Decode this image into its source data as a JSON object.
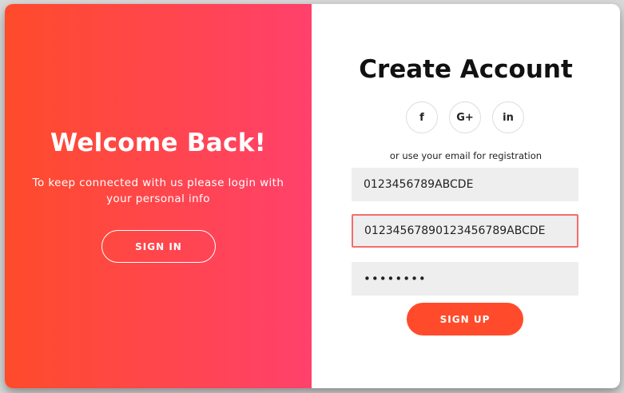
{
  "overlay": {
    "title": "Welcome Back!",
    "message": "To keep connected with us please login with your personal info",
    "signin_label": "SIGN IN"
  },
  "form": {
    "title": "Create Account",
    "social": [
      {
        "name": "facebook",
        "glyph": "f",
        "icon": "facebook-icon"
      },
      {
        "name": "google-plus",
        "glyph": "G+",
        "icon": "google-plus-icon"
      },
      {
        "name": "linkedin",
        "glyph": "in",
        "icon": "linkedin-icon"
      }
    ],
    "hint": "or use your email for registration",
    "name_value": "0123456789ABCDE",
    "email_value": "01234567890123456789ABCDE",
    "password_value": "abcdefgh",
    "signup_label": "SIGN UP"
  },
  "colors": {
    "gradient_start": "#ff4b2b",
    "gradient_end": "#ff416c",
    "button": "#ff4b2b",
    "input_bg": "#eeeeee",
    "focus_border": "#f26d6d"
  }
}
